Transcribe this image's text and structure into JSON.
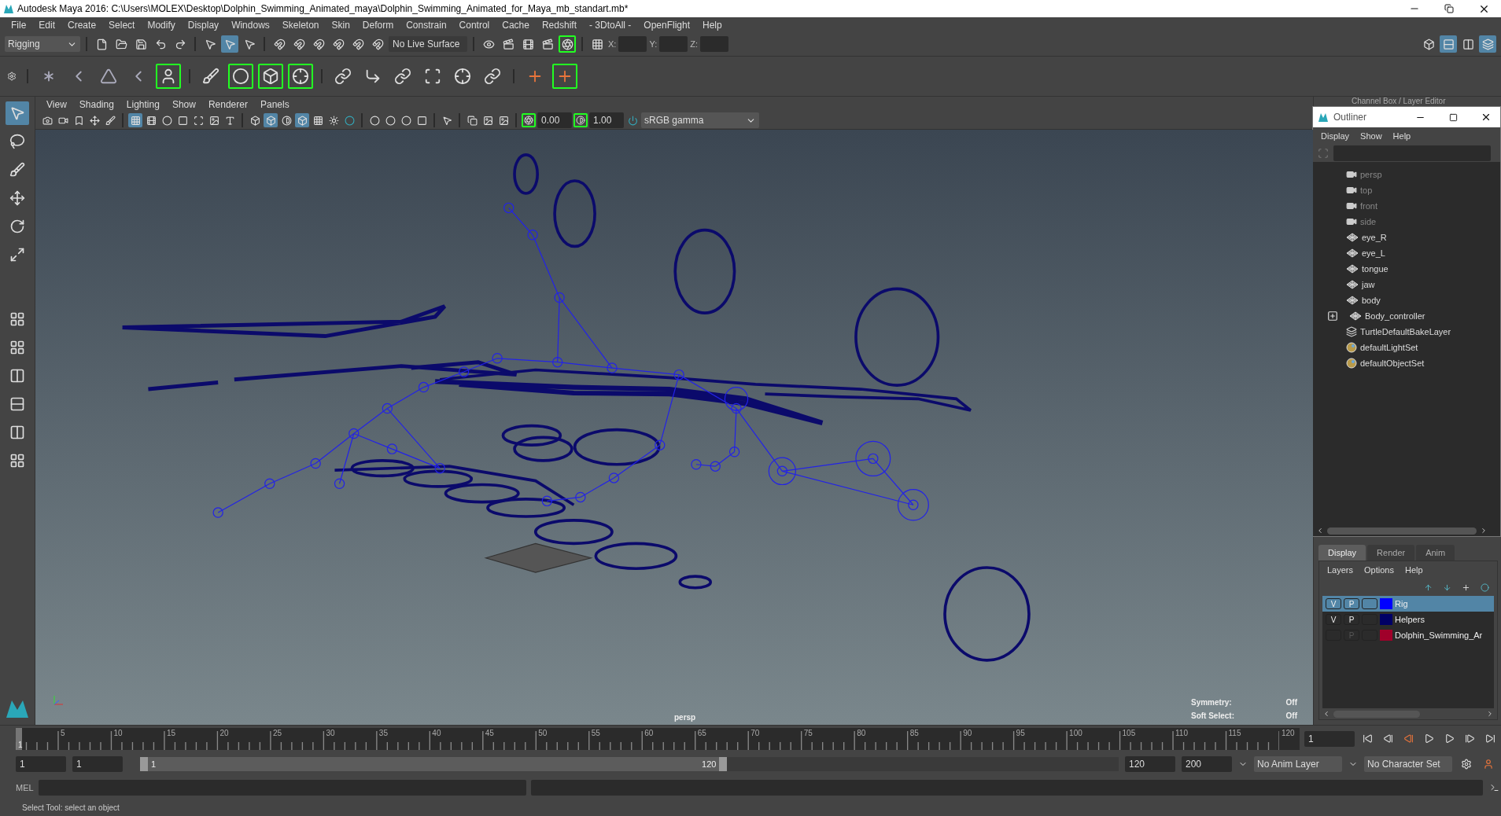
{
  "window": {
    "title": "Autodesk Maya 2016: C:\\Users\\MOLEX\\Desktop\\Dolphin_Swimming_Animated_maya\\Dolphin_Swimming_Animated_for_Maya_mb_standart.mb*"
  },
  "menu_bar": [
    "File",
    "Edit",
    "Create",
    "Select",
    "Modify",
    "Display",
    "Windows",
    "Skeleton",
    "Skin",
    "Deform",
    "Constrain",
    "Control",
    "Cache",
    "Redshift",
    "- 3DtoAll -",
    "OpenFlight",
    "Help"
  ],
  "status_line": {
    "menu_set": "Rigging",
    "live_surface": "No Live Surface",
    "coords": [
      "X:",
      "Y:",
      "Z:"
    ]
  },
  "panel_menu": [
    "View",
    "Shading",
    "Lighting",
    "Show",
    "Renderer",
    "Panels"
  ],
  "panel_toolbar": {
    "exposure": "0.00",
    "gamma": "1.00",
    "color_space": "sRGB gamma"
  },
  "viewport": {
    "camera": "persp",
    "hud": [
      {
        "label": "Symmetry:",
        "value": "Off"
      },
      {
        "label": "Soft Select:",
        "value": "Off"
      }
    ]
  },
  "channel_box": {
    "title": "Channel Box / Layer Editor"
  },
  "outliner": {
    "title": "Outliner",
    "menu": [
      "Display",
      "Show",
      "Help"
    ],
    "items": [
      {
        "label": "persp",
        "kind": "camera",
        "dimmed": true,
        "expandable": false
      },
      {
        "label": "top",
        "kind": "camera",
        "dimmed": true,
        "expandable": false
      },
      {
        "label": "front",
        "kind": "camera",
        "dimmed": true,
        "expandable": false
      },
      {
        "label": "side",
        "kind": "camera",
        "dimmed": true,
        "expandable": false
      },
      {
        "label": "eye_R",
        "kind": "mesh",
        "dimmed": false,
        "expandable": false
      },
      {
        "label": "eye_L",
        "kind": "mesh",
        "dimmed": false,
        "expandable": false
      },
      {
        "label": "tongue",
        "kind": "mesh",
        "dimmed": false,
        "expandable": false
      },
      {
        "label": "jaw",
        "kind": "mesh",
        "dimmed": false,
        "expandable": false
      },
      {
        "label": "body",
        "kind": "mesh",
        "dimmed": false,
        "expandable": false
      },
      {
        "label": "Body_controller",
        "kind": "mesh",
        "dimmed": false,
        "expandable": true
      },
      {
        "label": "TurtleDefaultBakeLayer",
        "kind": "layer",
        "dimmed": false,
        "expandable": false
      },
      {
        "label": "defaultLightSet",
        "kind": "set",
        "dimmed": false,
        "expandable": false
      },
      {
        "label": "defaultObjectSet",
        "kind": "set",
        "dimmed": false,
        "expandable": false
      }
    ]
  },
  "layer_editor": {
    "tabs": [
      {
        "label": "Display",
        "selected": true
      },
      {
        "label": "Render",
        "selected": false
      },
      {
        "label": "Anim",
        "selected": false
      }
    ],
    "menu": [
      "Layers",
      "Options",
      "Help"
    ],
    "layers": [
      {
        "name": "Rig",
        "color": "#0000ff",
        "selected": true,
        "v": "V",
        "p": "P",
        "p_dimmed": false
      },
      {
        "name": "Helpers",
        "color": "#000066",
        "selected": false,
        "v": "V",
        "p": "P",
        "p_dimmed": false
      },
      {
        "name": "Dolphin_Swimming_Ar",
        "color": "#a0002a",
        "selected": false,
        "p": "P",
        "p_dimmed": true
      }
    ]
  },
  "time_slider": {
    "start": "1",
    "ticks": [
      "5",
      "10",
      "15",
      "20",
      "25",
      "30",
      "35",
      "40",
      "45",
      "50",
      "55",
      "60",
      "65",
      "70",
      "75",
      "80",
      "85",
      "90",
      "95",
      "100",
      "105",
      "110",
      "115",
      "120"
    ],
    "current_frame": "1",
    "level": 0
  },
  "range_slider": {
    "start": "1",
    "playback_start": "1",
    "bar_start": "1",
    "bar_end": "120",
    "level": 0.6,
    "playback_end": "120",
    "end": "200",
    "anim_layer": "No Anim Layer",
    "character_set": "No Character Set"
  },
  "command_line": {
    "language": "MEL"
  },
  "help_line": "Select Tool: select an object"
}
